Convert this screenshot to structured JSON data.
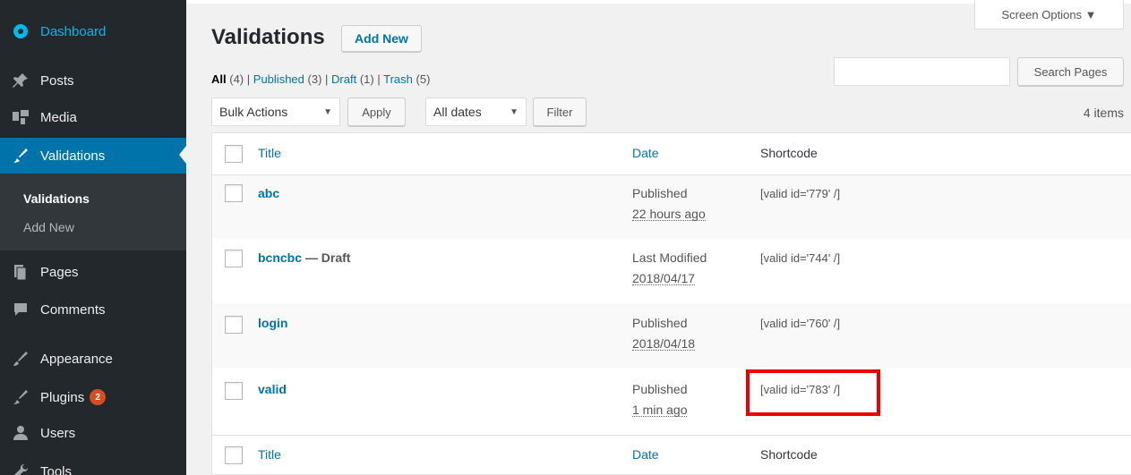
{
  "sidebar": {
    "dashboard": "Dashboard",
    "posts": "Posts",
    "media": "Media",
    "validations": "Validations",
    "submenu": {
      "current": "Validations",
      "add_new": "Add New"
    },
    "pages": "Pages",
    "comments": "Comments",
    "appearance": "Appearance",
    "plugins": "Plugins",
    "plugins_badge": "2",
    "users": "Users",
    "tools": "Tools"
  },
  "header": {
    "title": "Validations",
    "add_new": "Add New",
    "screen_options": "Screen Options ▼"
  },
  "filters": {
    "all": "All",
    "all_count": "(4)",
    "published": "Published",
    "published_count": "(3)",
    "draft": "Draft",
    "draft_count": "(1)",
    "trash": "Trash",
    "trash_count": "(5)",
    "sep": "|"
  },
  "search": {
    "button": "Search Pages",
    "value": ""
  },
  "bulk": {
    "actions_selected": "Bulk Actions",
    "apply": "Apply",
    "dates_selected": "All dates",
    "filter": "Filter",
    "item_count": "4 items"
  },
  "table": {
    "headers": {
      "title": "Title",
      "date": "Date",
      "shortcode": "Shortcode"
    },
    "rows": [
      {
        "title": "abc",
        "state": "",
        "status": "Published",
        "date": "22 hours ago",
        "shortcode": "[valid id='779' /]"
      },
      {
        "title": "bcncbc",
        "state": " — Draft",
        "status": "Last Modified",
        "date": "2018/04/17",
        "shortcode": "[valid id='744' /]"
      },
      {
        "title": "login",
        "state": "",
        "status": "Published",
        "date": "2018/04/18",
        "shortcode": "[valid id='760' /]"
      },
      {
        "title": "valid",
        "state": "",
        "status": "Published",
        "date": "1 min ago",
        "shortcode": "[valid id='783' /]"
      }
    ]
  },
  "colors": {
    "sidebar_bg": "#23282d",
    "active_bg": "#0073aa",
    "link": "#0073aa",
    "highlight": "#ee0000",
    "badge": "#d54e21"
  },
  "icons": [
    "dashboard-icon",
    "posts-pin-icon",
    "media-icon",
    "validations-brush-icon",
    "pages-icon",
    "comments-icon",
    "appearance-brush-icon",
    "plugins-icon",
    "users-icon",
    "tools-icon",
    "dropdown-arrow-icon"
  ]
}
